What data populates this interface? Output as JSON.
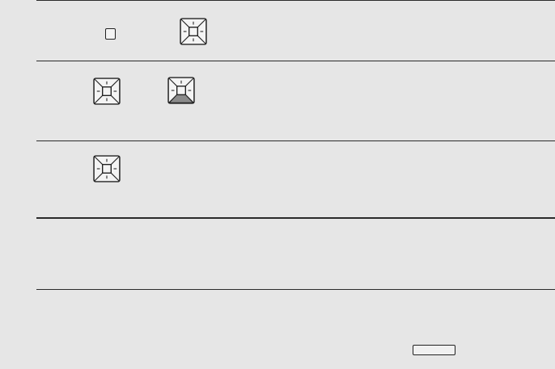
{
  "sections": [
    {
      "id": "row-1",
      "controls": [
        "square-key",
        "arrow-keypad"
      ]
    },
    {
      "id": "row-2",
      "controls": [
        "arrow-keypad",
        "arrow-keypad-pressed-bottom"
      ]
    },
    {
      "id": "row-3",
      "controls": [
        "arrow-keypad"
      ]
    },
    {
      "id": "row-4",
      "controls": []
    },
    {
      "id": "row-5",
      "controls": [
        "wide-key"
      ]
    }
  ],
  "icons": {
    "keypad": "four-way-arrow-keypad-icon",
    "square_key": "square-key-icon",
    "wide_key": "wide-key-icon"
  },
  "colors": {
    "background": "#e6e6e6",
    "line": "#2b2b2b",
    "key_face": "#f4f4f4",
    "pressed_segment": "#8a8a8a"
  }
}
